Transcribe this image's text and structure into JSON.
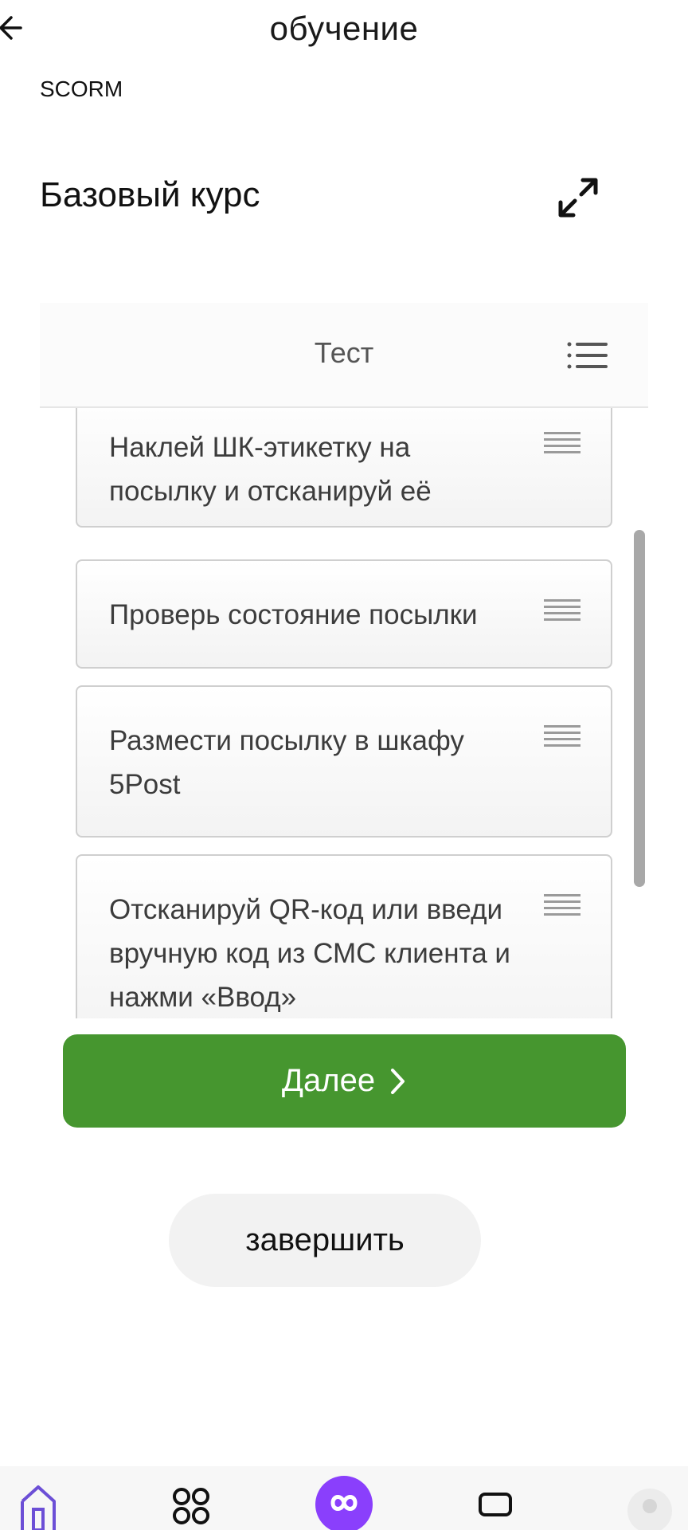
{
  "header": {
    "title": "обучение",
    "back_icon": "arrow-left-icon"
  },
  "course": {
    "format_label": "SCORM",
    "title": "Базовый курс",
    "expand_icon": "expand-icon"
  },
  "scorm": {
    "test_title": "Тест",
    "menu_icon": "list-menu-icon",
    "items": [
      {
        "label": "Наклей ШК-этикетку на посылку и отсканируй её"
      },
      {
        "label": "Проверь состояние посылки"
      },
      {
        "label": "Размести посылку в шкафу 5Post"
      },
      {
        "label": "Отсканируй QR-код или введи вручную код из СМС клиента и нажми «Ввод»"
      }
    ],
    "next_label": "Далее"
  },
  "actions": {
    "finish_label": "завершить"
  },
  "bottom_nav": {
    "items": [
      "home-icon",
      "grid-icon",
      "logo-icon",
      "card-icon",
      "profile-icon"
    ]
  },
  "colors": {
    "next_button": "#46962f",
    "brand_purple": "#8a3ffc",
    "nav_purple": "#6c4fd6"
  }
}
